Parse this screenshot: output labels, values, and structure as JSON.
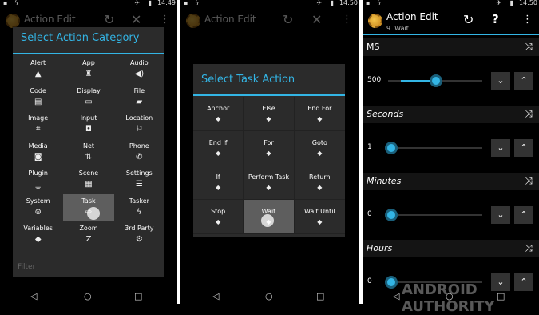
{
  "screen1": {
    "status_time": "14:49",
    "actionbar_title": "Action Edit",
    "dialog_title": "Select Action Category",
    "categories": [
      {
        "label": "Alert",
        "icon": "warning-icon"
      },
      {
        "label": "App",
        "icon": "rocket-icon"
      },
      {
        "label": "Audio",
        "icon": "speaker-icon"
      },
      {
        "label": "Code",
        "icon": "document-icon"
      },
      {
        "label": "Display",
        "icon": "monitor-icon"
      },
      {
        "label": "File",
        "icon": "folder-icon"
      },
      {
        "label": "Image",
        "icon": "crop-icon"
      },
      {
        "label": "Input",
        "icon": "mouse-icon"
      },
      {
        "label": "Location",
        "icon": "flag-icon"
      },
      {
        "label": "Media",
        "icon": "camera-icon"
      },
      {
        "label": "Net",
        "icon": "network-icon"
      },
      {
        "label": "Phone",
        "icon": "phone-icon"
      },
      {
        "label": "Plugin",
        "icon": "plug-icon"
      },
      {
        "label": "Scene",
        "icon": "scene-icon"
      },
      {
        "label": "Settings",
        "icon": "sliders-icon"
      },
      {
        "label": "System",
        "icon": "android-icon"
      },
      {
        "label": "Task",
        "icon": "task-icon"
      },
      {
        "label": "Tasker",
        "icon": "bolt-icon"
      },
      {
        "label": "Variables",
        "icon": "tag-icon"
      },
      {
        "label": "Zoom",
        "icon": "zoom-icon"
      },
      {
        "label": "3rd Party",
        "icon": "third-party-icon"
      }
    ],
    "selected": "Task",
    "filter_placeholder": "Filter"
  },
  "screen2": {
    "status_time": "14:50",
    "actionbar_title": "Action Edit",
    "dialog_title": "Select Task Action",
    "actions": [
      "Anchor",
      "Else",
      "End For",
      "End If",
      "For",
      "Goto",
      "If",
      "Perform Task",
      "Return",
      "Stop",
      "Wait",
      "Wait Until"
    ],
    "selected": "Wait"
  },
  "screen3": {
    "status_time": "14:50",
    "actionbar_title": "Action Edit",
    "actionbar_subtitle": "9. Wait",
    "params": [
      {
        "name": "MS",
        "value": "500",
        "fraction": 0.37
      },
      {
        "name": "Seconds",
        "value": "1",
        "fraction": 0.0
      },
      {
        "name": "Minutes",
        "value": "0",
        "fraction": 0.0
      },
      {
        "name": "Hours",
        "value": "0",
        "fraction": 0.0
      }
    ]
  },
  "watermark": "ANDROID AUTHORITY",
  "accent_color": "#33b5e5"
}
